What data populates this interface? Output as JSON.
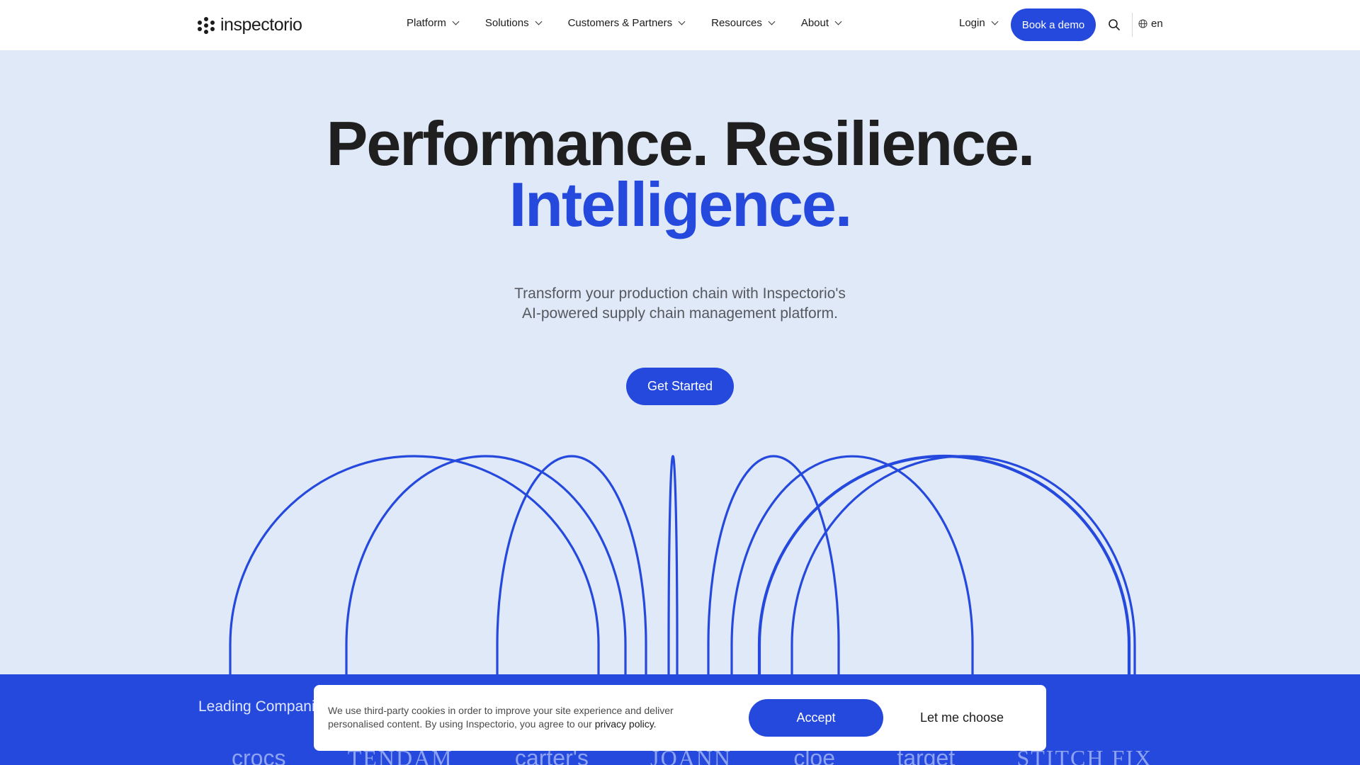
{
  "header": {
    "logo_text": "inspectorio",
    "nav": [
      {
        "label": "Platform"
      },
      {
        "label": "Solutions"
      },
      {
        "label": "Customers & Partners"
      },
      {
        "label": "Resources"
      },
      {
        "label": "About"
      }
    ],
    "login_label": "Login",
    "demo_label": "Book a demo",
    "lang_label": "en"
  },
  "hero": {
    "title_line1": "Performance. Resilience.",
    "title_line2": "Intelligence.",
    "subtitle_line1": "Transform your production chain with Inspectorio's",
    "subtitle_line2": "AI-powered supply chain management platform.",
    "cta_label": "Get Started"
  },
  "band": {
    "title": "Leading Compani",
    "logos": [
      "crocs",
      "TENDAM",
      "carter's",
      "JOANN",
      "cloe",
      "target",
      "STITCH FIX"
    ]
  },
  "cookie": {
    "text": "We use third-party cookies in order to improve your site experience and deliver personalised content. By using Inspectorio, you agree to our",
    "link": "privacy policy.",
    "accept_label": "Accept",
    "choose_label": "Let me choose"
  },
  "colors": {
    "accent": "#2549dd",
    "hero_bg": "#e0e9f8",
    "header_bg": "#ffffff"
  }
}
